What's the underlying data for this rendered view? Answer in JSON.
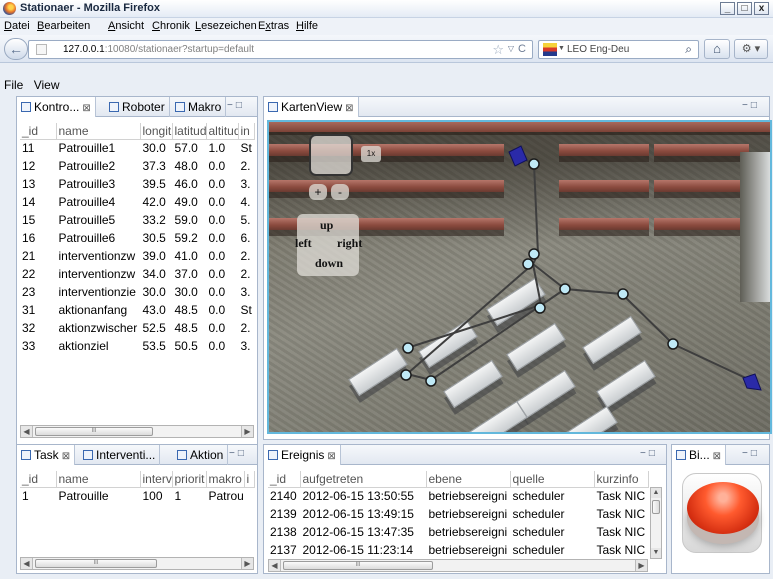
{
  "browser": {
    "title": "Stationaer - Mozilla Firefox",
    "window_buttons": [
      "_",
      "□",
      "x"
    ],
    "menu": [
      {
        "label": "Datei",
        "key": "D"
      },
      {
        "label": "Bearbeiten",
        "key": "B"
      },
      {
        "label": "Ansicht",
        "key": "A"
      },
      {
        "label": "Chronik",
        "key": "C"
      },
      {
        "label": "Lesezeichen",
        "key": "L"
      },
      {
        "label": "Extras",
        "key": "x"
      },
      {
        "label": "Hilfe",
        "key": "H"
      }
    ],
    "url_host": "127.0.0.1",
    "url_rest": ":10080/stationaer?startup=default",
    "search_placeholder": "LEO Eng-Deu"
  },
  "app_menu": [
    "File",
    "View"
  ],
  "left_top": {
    "tabs": [
      {
        "label": "Kontro...",
        "close": "⊠"
      },
      {
        "label": "Roboter"
      },
      {
        "label": "Makro"
      }
    ],
    "columns": [
      "_id",
      "name",
      "longit",
      "latitud",
      "altitud",
      "in"
    ],
    "rows": [
      [
        "11",
        "Patrouille1",
        "30.0",
        "57.0",
        "1.0",
        "St"
      ],
      [
        "12",
        "Patrouille2",
        "37.3",
        "48.0",
        "0.0",
        "2."
      ],
      [
        "13",
        "Patrouille3",
        "39.5",
        "46.0",
        "0.0",
        "3."
      ],
      [
        "14",
        "Patrouille4",
        "42.0",
        "49.0",
        "0.0",
        "4."
      ],
      [
        "15",
        "Patrouille5",
        "33.2",
        "59.0",
        "0.0",
        "5."
      ],
      [
        "16",
        "Patrouille6",
        "30.5",
        "59.2",
        "0.0",
        "6."
      ],
      [
        "21",
        "interventionzw",
        "39.0",
        "41.0",
        "0.0",
        "2."
      ],
      [
        "22",
        "interventionzw",
        "34.0",
        "37.0",
        "0.0",
        "2."
      ],
      [
        "23",
        "interventionzie",
        "30.0",
        "30.0",
        "0.0",
        "3."
      ],
      [
        "31",
        "aktionanfang",
        "43.0",
        "48.5",
        "0.0",
        "St"
      ],
      [
        "32",
        "aktionzwischer",
        "52.5",
        "48.5",
        "0.0",
        "2."
      ],
      [
        "33",
        "aktionziel",
        "53.5",
        "50.5",
        "0.0",
        "3."
      ]
    ]
  },
  "map": {
    "tab": "KartenView",
    "close": "⊠",
    "zoom_label": "1x",
    "zoom_in": "+",
    "zoom_out": "-",
    "nav": {
      "up": "up",
      "left": "left",
      "right": "right",
      "down": "down"
    }
  },
  "left_bottom": {
    "tabs": [
      {
        "label": "Task",
        "close": "⊠"
      },
      {
        "label": "Interventi..."
      },
      {
        "label": "Aktion"
      }
    ],
    "columns": [
      "_id",
      "name",
      "interv",
      "priorit",
      "makro",
      "i"
    ],
    "rows": [
      [
        "1",
        "Patrouille",
        "100",
        "1",
        "Patroui",
        ""
      ]
    ]
  },
  "ereignis": {
    "tab": "Ereignis",
    "close": "⊠",
    "columns": [
      "_id",
      "aufgetreten",
      "ebene",
      "quelle",
      "kurzinfo"
    ],
    "rows": [
      [
        "2140",
        "2012-06-15 13:50:55",
        "betriebsereigni",
        "scheduler",
        "Task NIC"
      ],
      [
        "2139",
        "2012-06-15 13:49:15",
        "betriebsereigni",
        "scheduler",
        "Task NIC"
      ],
      [
        "2138",
        "2012-06-15 13:47:35",
        "betriebsereigni",
        "scheduler",
        "Task NIC"
      ],
      [
        "2137",
        "2012-06-15 11:23:14",
        "betriebsereigni",
        "scheduler",
        "Task NIC"
      ]
    ]
  },
  "right_bottom": {
    "tab": "Bi...",
    "close": "⊠"
  },
  "scroll_thumb": "III",
  "colors": {
    "map_border": "#63b8dc",
    "waypoint": "#bfe9f6",
    "robot": "#2a2aa8",
    "red_button": "#ff5a2e"
  }
}
